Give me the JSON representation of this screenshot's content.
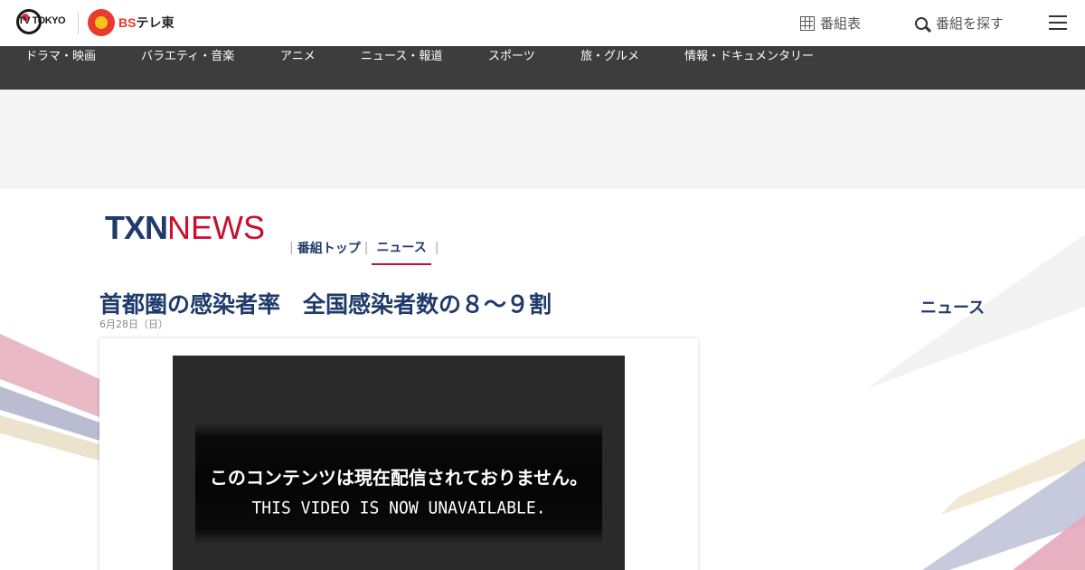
{
  "header": {
    "tvtokyo_logo": "TV TOKYO",
    "bs_logo_prefix": "BS",
    "bs_logo_suffix": "テレ東",
    "schedule_label": "番組表",
    "search_label": "番組を探す"
  },
  "nav": {
    "items": [
      {
        "label": "ドラマ・映画"
      },
      {
        "label": "バラエティ・音楽"
      },
      {
        "label": "アニメ"
      },
      {
        "label": "ニュース・報道"
      },
      {
        "label": "スポーツ"
      },
      {
        "label": "旅・グルメ"
      },
      {
        "label": "情報・ドキュメンタリー"
      }
    ]
  },
  "program": {
    "logo_txn": "TXN",
    "logo_news": "NEWS",
    "tabs": [
      {
        "label": "番組トップ"
      },
      {
        "label": "ニュース"
      }
    ],
    "active_tab": "ニュース"
  },
  "article": {
    "title": "首都圏の感染者率　全国感染者数の８～９割",
    "date": "6月28日（日）"
  },
  "video": {
    "message_jp": "このコンテンツは現在配信されておりません。",
    "message_en": "THIS VIDEO IS NOW UNAVAILABLE."
  },
  "sidebar": {
    "heading": "ニュース"
  },
  "colors": {
    "brand_navy": "#1f3a6b",
    "brand_red": "#c8102e",
    "nav_bg": "#3d3d3d",
    "ad_bg": "#f5f5f5"
  },
  "icons": [
    "grid-icon",
    "search-icon",
    "hamburger-menu-icon"
  ]
}
